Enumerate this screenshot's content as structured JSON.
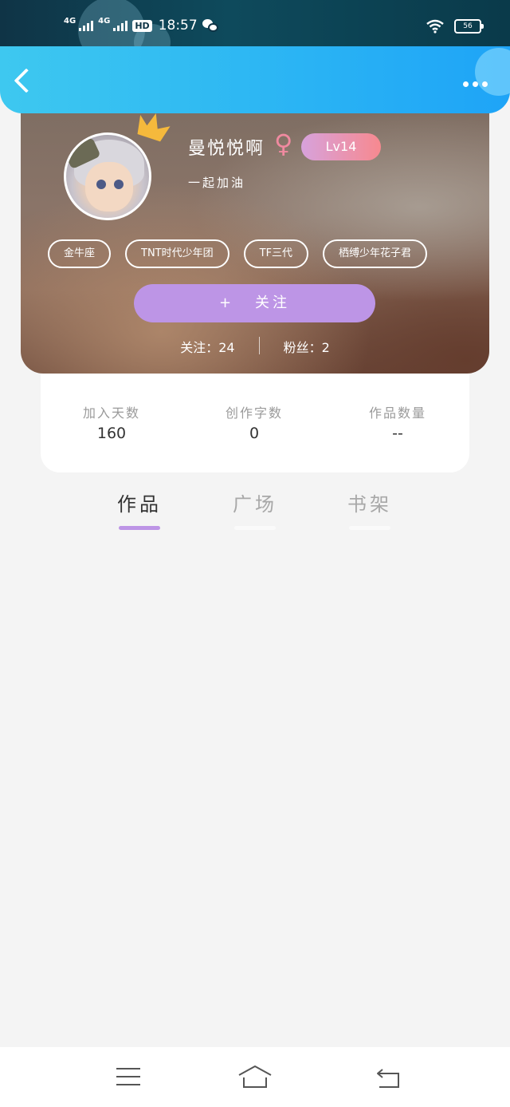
{
  "status_bar": {
    "network1": "4G",
    "network2": "4G",
    "hd": "HD",
    "time": "18:57",
    "battery": "56"
  },
  "profile": {
    "username": "曼悦悦啊",
    "gender_symbol": "♀",
    "level": "Lv14",
    "signature": "一起加油",
    "tags": [
      "金牛座",
      "TNT时代少年团",
      "TF三代",
      "栖缚少年花子君"
    ],
    "follow_button": {
      "plus": "+",
      "label": "关注"
    },
    "following": "关注：24",
    "followers": "粉丝：2"
  },
  "stats": [
    {
      "label": "加入天数",
      "value": "160"
    },
    {
      "label": "创作字数",
      "value": "0"
    },
    {
      "label": "作品数量",
      "value": "--"
    }
  ],
  "tabs": [
    {
      "label": "作品",
      "active": true
    },
    {
      "label": "广场",
      "active": false
    },
    {
      "label": "书架",
      "active": false
    }
  ],
  "colors": {
    "header": "#2db7f3",
    "accent": "#bd95e6",
    "level_gradient_start": "#d7a2dc",
    "level_gradient_end": "#f7898f"
  },
  "icons": [
    "back-icon",
    "more-icon",
    "crown-icon",
    "female-icon",
    "menu-icon",
    "home-icon",
    "return-icon"
  ]
}
